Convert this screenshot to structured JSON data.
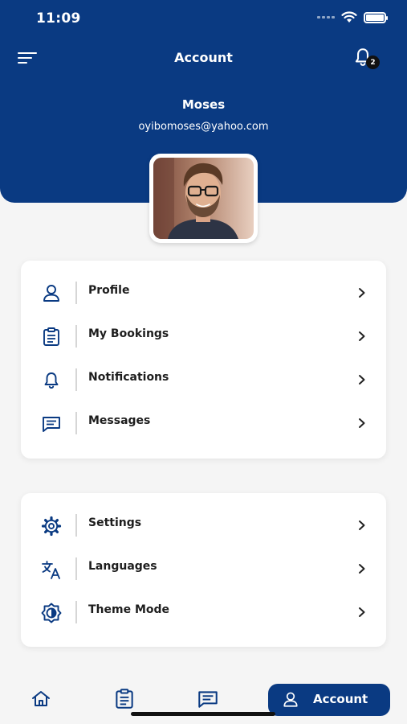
{
  "status_bar": {
    "time": "11:09"
  },
  "header": {
    "title": "Account",
    "notification_count": "2",
    "user_name": "Moses",
    "user_email": "oyibomoses@yahoo.com"
  },
  "menu_section_1": [
    {
      "label": "Profile",
      "icon": "user-icon"
    },
    {
      "label": "My Bookings",
      "icon": "clipboard-icon"
    },
    {
      "label": "Notifications",
      "icon": "bell-icon"
    },
    {
      "label": "Messages",
      "icon": "message-icon"
    }
  ],
  "menu_section_2": [
    {
      "label": "Settings",
      "icon": "gear-icon"
    },
    {
      "label": "Languages",
      "icon": "translate-icon"
    },
    {
      "label": "Theme Mode",
      "icon": "theme-icon"
    }
  ],
  "bottom_nav": {
    "items": [
      {
        "icon": "home-icon"
      },
      {
        "icon": "clipboard-icon"
      },
      {
        "icon": "message-icon"
      }
    ],
    "active_label": "Account"
  },
  "colors": {
    "primary": "#0a3a82",
    "background": "#f5f5f5"
  }
}
